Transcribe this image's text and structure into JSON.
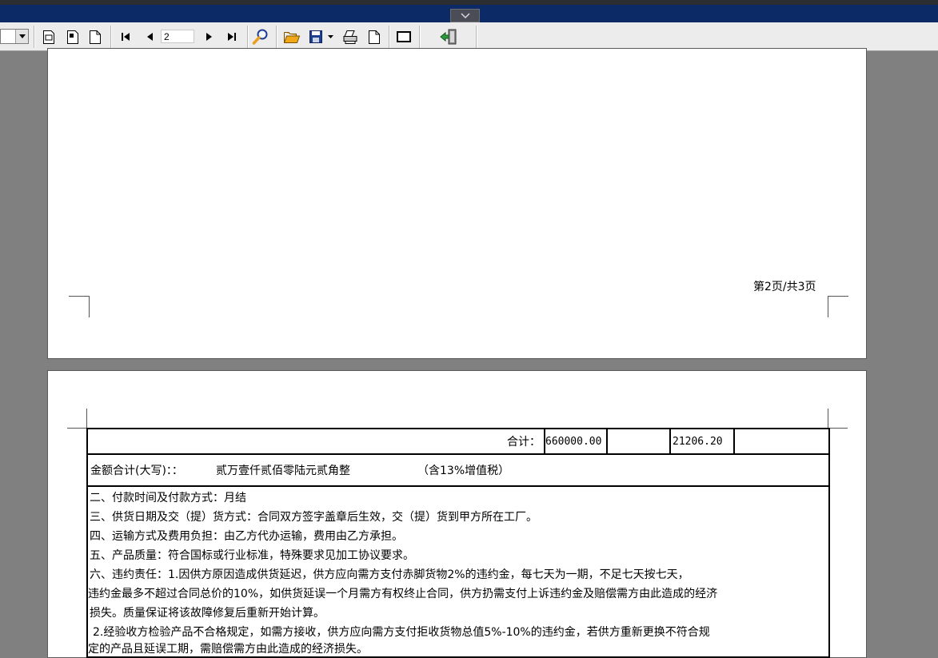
{
  "window": {
    "collapse_icon": "chevron-down-icon"
  },
  "toolbar": {
    "page_number": "2",
    "icons": [
      "dropdown-arrow-icon",
      "page-setup-icon",
      "page-layout-icon",
      "blank-page-icon",
      "first-page-icon",
      "previous-page-icon",
      "next-page-icon",
      "last-page-icon",
      "zoom-icon",
      "open-folder-icon",
      "save-icon",
      "save-dropdown-icon",
      "print-icon",
      "single-page-icon",
      "full-screen-icon",
      "exit-icon"
    ]
  },
  "page1": {
    "footer": "第2页/共3页"
  },
  "page2": {
    "total_label": "合计：",
    "total_amount": "660000.00",
    "total_tax": "21206.20",
    "amount_words_label": "金额合计(大写)：：",
    "amount_words": "贰万壹仟贰佰零陆元贰角整",
    "tax_note": "（含13%增值税）",
    "terms": [
      "二、付款时间及付款方式：月结",
      "三、供货日期及交（提）货方式：合同双方签字盖章后生效，交（提）货到甲方所在工厂。",
      "四、运输方式及费用负担：由乙方代办运输，费用由乙方承担。",
      "五、产品质量：符合国标或行业标准，特殊要求见加工协议要求。",
      "六、违约责任：1.因供方原因造成供货延迟，供方应向需方支付赤脚货物2%的违约金，每七天为一期，不足七天按七天，",
      "违约金最多不超过合同总价的10%，如供货延误一个月需方有权终止合同，供方扔需支付上诉违约金及赔偿需方由此造成的经济",
      "损失。质量保证将该故障修复后重新开始计算。",
      " 2.经验收方检验产品不合格规定，如需方接收，供方应向需方支付拒收货物总值5%-10%的违约金，若供方重新更换不符合规",
      "定的产品且延误工期，需赔偿需方由此造成的经济损失。"
    ]
  },
  "colors": {
    "titlebar": "#0c2a66",
    "toolbar": "#ececec",
    "viewport": "#808080",
    "icon_orange": "#e8a020",
    "icon_blue": "#1f3f8f"
  }
}
